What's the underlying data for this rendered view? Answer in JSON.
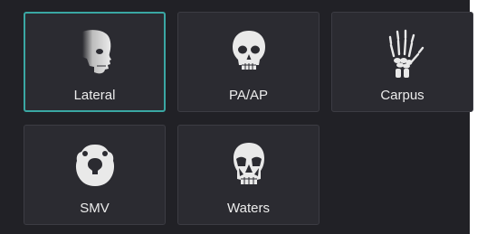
{
  "projection_grid": {
    "tiles": [
      {
        "label": "Lateral",
        "icon": "skull-lateral-icon",
        "selected": true
      },
      {
        "label": "PA/AP",
        "icon": "skull-frontal-icon",
        "selected": false
      },
      {
        "label": "Carpus",
        "icon": "hand-bones-icon",
        "selected": false
      },
      {
        "label": "SMV",
        "icon": "skull-base-icon",
        "selected": false
      },
      {
        "label": "Waters",
        "icon": "skull-waters-icon",
        "selected": false
      }
    ]
  },
  "colors": {
    "background": "#212126",
    "tile": "#2b2b31",
    "tile_border": "#3c3c43",
    "selected_border": "#3aa7a3",
    "icon": "#e9e9e9",
    "label": "#ececec"
  }
}
